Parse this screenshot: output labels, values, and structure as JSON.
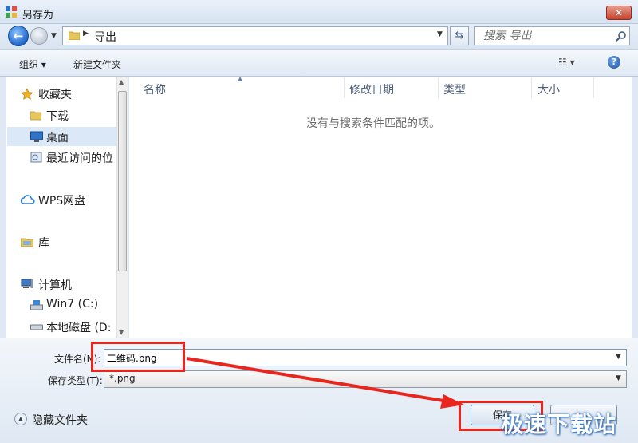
{
  "window": {
    "title": "另存为",
    "close_label": "✕"
  },
  "address": {
    "path": "导出"
  },
  "search": {
    "placeholder": "搜索 导出"
  },
  "toolbar": {
    "organize_label": "组织 ▾",
    "new_folder_label": "新建文件夹",
    "view_label": "☷ ▾",
    "help_label": "?"
  },
  "nav": {
    "favorites": "收藏夹",
    "downloads": "下载",
    "desktop": "桌面",
    "recent": "最近访问的位",
    "wps": "WPS网盘",
    "library": "库",
    "computer": "计算机",
    "drive_c": "Win7 (C:)",
    "drive_d": "本地磁盘 (D:"
  },
  "filelist": {
    "columns": [
      "名称",
      "修改日期",
      "类型",
      "大小"
    ],
    "empty_message": "没有与搜索条件匹配的项。"
  },
  "form": {
    "filename_label": "文件名(N):",
    "filename_value": "二维码.png",
    "filetype_label": "保存类型(T):",
    "filetype_value": "*.png"
  },
  "footer": {
    "hide_folders_label": "隐藏文件夹",
    "save_label": "保存",
    "cancel_label": ""
  },
  "watermark": {
    "text": "极速下载站"
  },
  "colors": {
    "annotation": "#e8261e",
    "selection": "#dbe8f7",
    "accent": "#1e66c9"
  }
}
